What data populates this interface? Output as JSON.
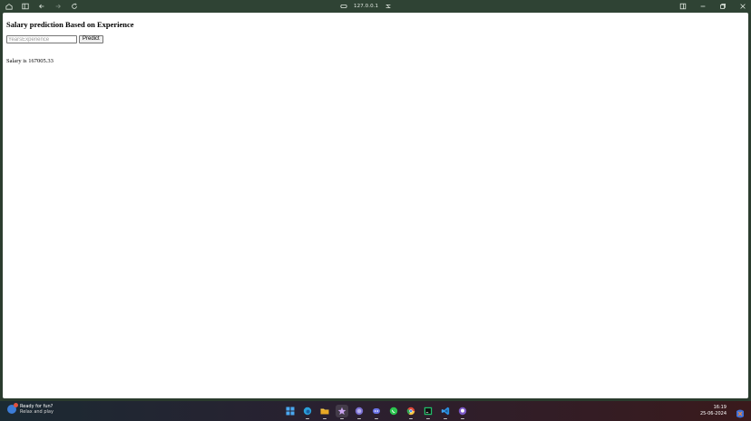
{
  "browser": {
    "url": "127.0.0.1"
  },
  "page": {
    "title": "Salary prediction Based on Experience",
    "input_placeholder": "YearsExperience",
    "button_label": "Predict",
    "result_text": "Salary is 167005.33"
  },
  "taskbar": {
    "notification_title": "Ready for fun?",
    "notification_subtitle": "Relax and play",
    "time": "16:19",
    "date": "25-06-2024"
  },
  "colors": {
    "titlebar": "#2f4334",
    "window_frame": "#2d3f31",
    "page_bg": "#ffffff"
  }
}
